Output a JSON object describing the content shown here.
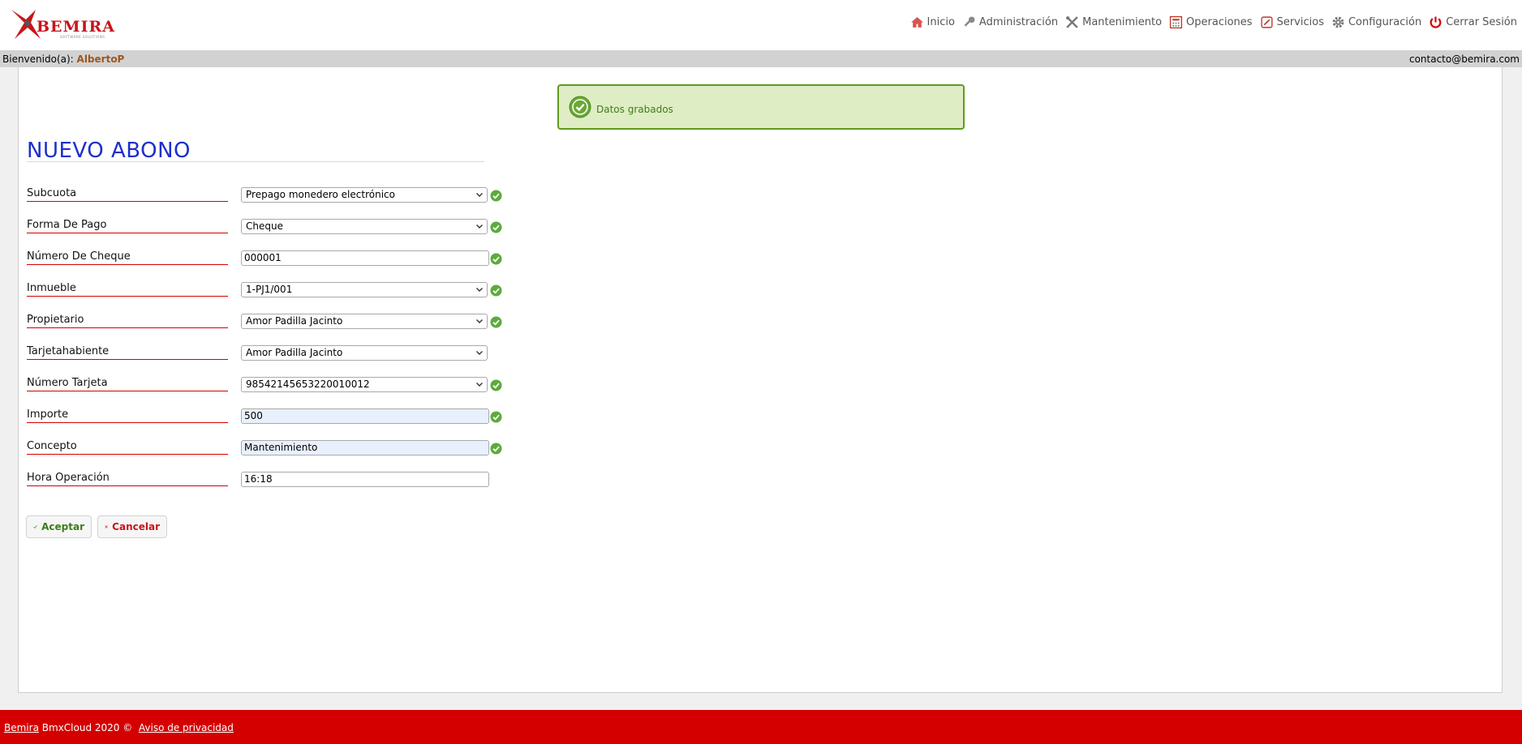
{
  "brand": {
    "logo_text": "BEMIRA",
    "logo_tagline": "SOFTWARE SOLUTIONS"
  },
  "nav": {
    "items": [
      {
        "label": "Inicio",
        "icon": "home-icon"
      },
      {
        "label": "Administración",
        "icon": "key-icon"
      },
      {
        "label": "Mantenimiento",
        "icon": "tools-icon"
      },
      {
        "label": "Operaciones",
        "icon": "calculator-icon"
      },
      {
        "label": "Servicios",
        "icon": "services-icon"
      },
      {
        "label": "Configuración",
        "icon": "gear-icon"
      },
      {
        "label": "Cerrar Sesión",
        "icon": "power-icon"
      }
    ]
  },
  "welcome": {
    "prefix": "Bienvenido(a):",
    "user": "AlbertoP",
    "contact": "contacto@bemira.com"
  },
  "notice": {
    "text": "Datos grabados"
  },
  "page": {
    "title": "NUEVO ABONO"
  },
  "form": {
    "fields": [
      {
        "label": "Subcuota",
        "value": "Prepago monedero electrónico",
        "type": "select",
        "valid": true
      },
      {
        "label": "Forma De Pago",
        "value": "Cheque",
        "type": "select",
        "valid": true
      },
      {
        "label": "Número De Cheque",
        "value": "000001",
        "type": "text",
        "valid": true
      },
      {
        "label": "Inmueble",
        "value": "1-PJ1/001",
        "type": "select",
        "valid": true
      },
      {
        "label": "Propietario",
        "value": "Amor Padilla Jacinto",
        "type": "select",
        "valid": true
      },
      {
        "label": "Tarjetahabiente",
        "value": "Amor Padilla Jacinto",
        "type": "select",
        "valid": false
      },
      {
        "label": "Número Tarjeta",
        "value": "98542145653220010012",
        "type": "select",
        "valid": true
      },
      {
        "label": "Importe",
        "value": "500",
        "type": "text",
        "valid": true
      },
      {
        "label": "Concepto",
        "value": "Mantenimiento",
        "type": "text",
        "valid": true
      },
      {
        "label": "Hora Operación",
        "value": "16:18",
        "type": "text",
        "valid": false
      }
    ],
    "accept_label": "Aceptar",
    "cancel_label": "Cancelar"
  },
  "footer": {
    "brand_link": "Bemira",
    "copyright": "BmxCloud 2020 ©",
    "privacy_link": "Aviso de privacidad"
  },
  "colors": {
    "brand_red": "#d40000",
    "title_blue": "#1c2fcc",
    "success_green": "#5f9a1e",
    "success_bg": "#dfedc4"
  }
}
